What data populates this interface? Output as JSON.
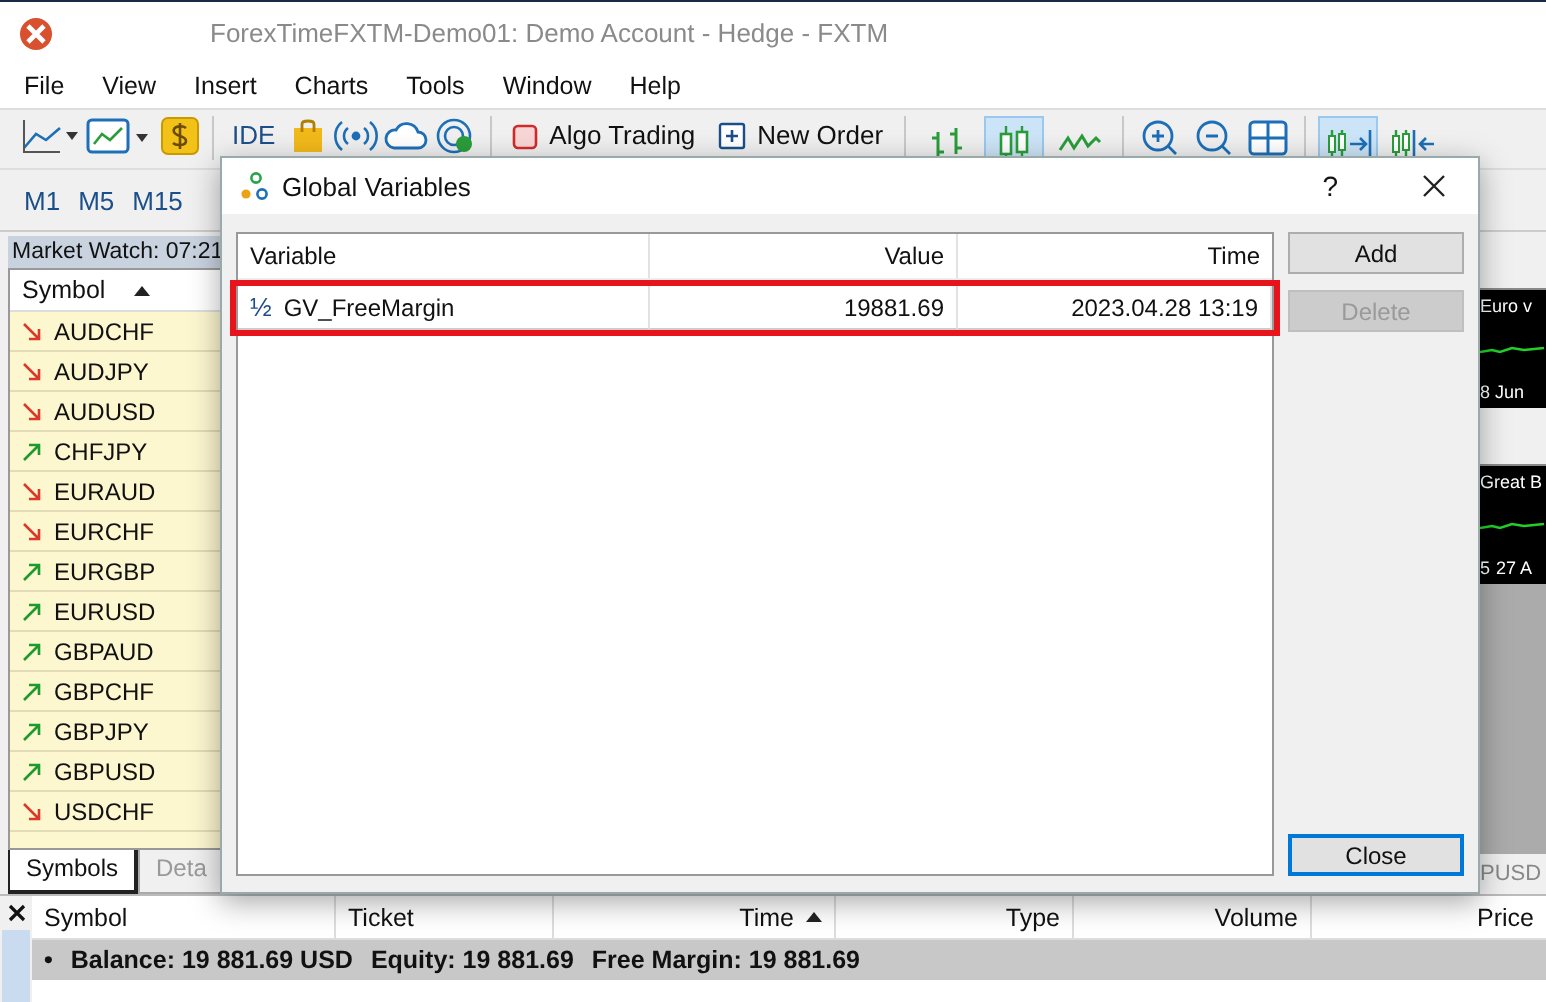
{
  "window": {
    "title": "ForexTimeFXTM-Demo01: Demo Account - Hedge - FXTM"
  },
  "menu": [
    "File",
    "View",
    "Insert",
    "Charts",
    "Tools",
    "Window",
    "Help"
  ],
  "toolbar": {
    "ide": "IDE",
    "algo_trading": "Algo Trading",
    "new_order": "New Order",
    "chart_modes": [
      {
        "kind": "bars",
        "selected": false
      },
      {
        "kind": "candles",
        "selected": true
      },
      {
        "kind": "line",
        "selected": false
      }
    ],
    "autoscroll": {
      "selected": true
    },
    "chart_shift": {
      "selected": false
    }
  },
  "timeframes": [
    "M1",
    "M5",
    "M15"
  ],
  "market_watch": {
    "title": "Market Watch: 07:21",
    "column": "Symbol",
    "rows": [
      {
        "symbol": "AUDCHF",
        "kind": "down"
      },
      {
        "symbol": "AUDJPY",
        "kind": "down"
      },
      {
        "symbol": "AUDUSD",
        "kind": "down"
      },
      {
        "symbol": "CHFJPY",
        "kind": "up"
      },
      {
        "symbol": "EURAUD",
        "kind": "down"
      },
      {
        "symbol": "EURCHF",
        "kind": "down"
      },
      {
        "symbol": "EURGBP",
        "kind": "up"
      },
      {
        "symbol": "EURUSD",
        "kind": "up"
      },
      {
        "symbol": "GBPAUD",
        "kind": "up"
      },
      {
        "symbol": "GBPCHF",
        "kind": "up"
      },
      {
        "symbol": "GBPJPY",
        "kind": "up"
      },
      {
        "symbol": "GBPUSD",
        "kind": "up"
      },
      {
        "symbol": "USDCHF",
        "kind": "down"
      }
    ],
    "tabs": [
      {
        "label": "Symbols",
        "selected": true
      },
      {
        "label": "Deta",
        "selected": false
      }
    ]
  },
  "charts": [
    {
      "title": "Euro v",
      "date": "8 Jun"
    },
    {
      "title": "Great B",
      "tick": "5",
      "date": "27 A"
    }
  ],
  "chart_tab": "PUSD",
  "dialog": {
    "title": "Global Variables",
    "help": "?",
    "columns": [
      "Variable",
      "Value",
      "Time"
    ],
    "rows": [
      {
        "glyph": "½",
        "variable": "GV_FreeMargin",
        "value": "19881.69",
        "time": "2023.04.28 13:19",
        "highlighted": true
      }
    ],
    "buttons": [
      {
        "label": "Add",
        "disabled": false,
        "focused": false
      },
      {
        "label": "Delete",
        "disabled": true,
        "focused": false
      },
      {
        "label": "Close",
        "disabled": false,
        "focused": true
      }
    ]
  },
  "terminal": {
    "columns": [
      {
        "label": "Symbol",
        "sorted": false
      },
      {
        "label": "Ticket",
        "sorted": false
      },
      {
        "label": "Time",
        "sorted": true
      },
      {
        "label": "Type",
        "sorted": false
      },
      {
        "label": "Volume",
        "sorted": false
      },
      {
        "label": "Price",
        "sorted": false
      }
    ],
    "bullet": "•",
    "summary": [
      "Balance: 19 881.69 USD",
      "Equity: 19 881.69",
      "Free Margin: 19 881.69"
    ]
  }
}
